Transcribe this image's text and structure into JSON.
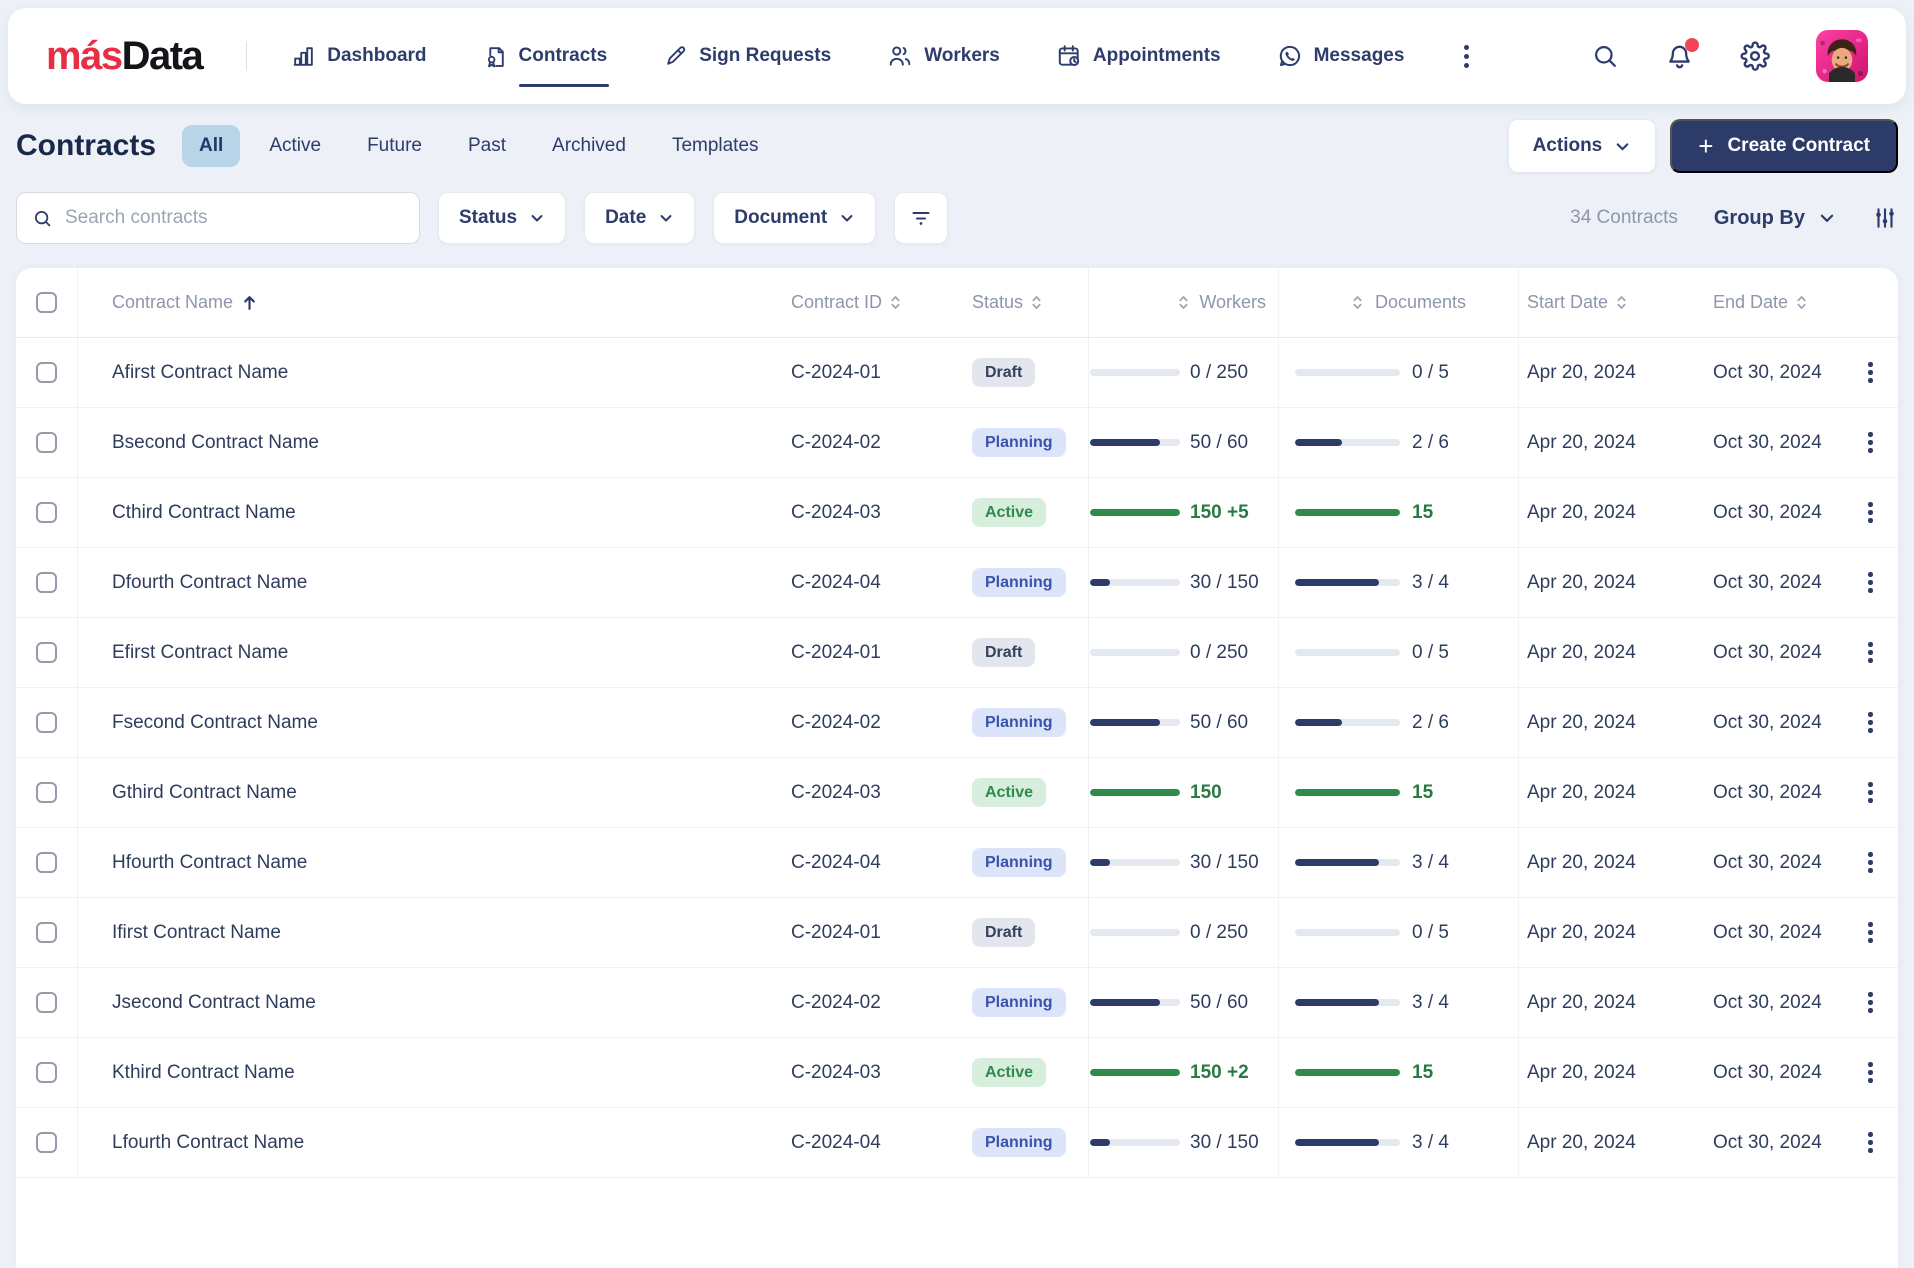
{
  "brand": {
    "red": "más",
    "dark": "Data"
  },
  "nav": {
    "items": [
      {
        "key": "dashboard",
        "label": "Dashboard",
        "active": false
      },
      {
        "key": "contracts",
        "label": "Contracts",
        "active": true
      },
      {
        "key": "sign-requests",
        "label": "Sign Requests",
        "active": false
      },
      {
        "key": "workers",
        "label": "Workers",
        "active": false
      },
      {
        "key": "appointments",
        "label": "Appointments",
        "active": false
      },
      {
        "key": "messages",
        "label": "Messages",
        "active": false
      }
    ]
  },
  "header": {
    "title": "Contracts",
    "tabs": [
      "All",
      "Active",
      "Future",
      "Past",
      "Archived",
      "Templates"
    ],
    "active_tab": "All",
    "actions_label": "Actions",
    "create_label": "Create Contract"
  },
  "filters": {
    "search_placeholder": "Search contracts",
    "dropdowns": [
      "Status",
      "Date",
      "Document"
    ],
    "count_label": "34 Contracts",
    "group_by_label": "Group By"
  },
  "table": {
    "columns": [
      {
        "label": "Contract Name",
        "sort": "asc"
      },
      {
        "label": "Contract ID",
        "sort": "none"
      },
      {
        "label": "Status",
        "sort": "none"
      },
      {
        "label": "Workers",
        "sort": "none"
      },
      {
        "label": "Documents",
        "sort": "none"
      },
      {
        "label": "Start Date",
        "sort": "none"
      },
      {
        "label": "End Date",
        "sort": "none"
      }
    ],
    "rows": [
      {
        "name": "Afirst Contract Name",
        "id": "C-2024-01",
        "status": "Draft",
        "status_type": "draft",
        "accent": "navy",
        "workers": {
          "pct": 0,
          "label": "0 / 250"
        },
        "documents": {
          "pct": 0,
          "label": "0 / 5"
        },
        "start": "Apr 20, 2024",
        "end": "Oct 30, 2024"
      },
      {
        "name": "Bsecond Contract Name",
        "id": "C-2024-02",
        "status": "Planning",
        "status_type": "planning",
        "accent": "navy",
        "workers": {
          "pct": 78,
          "label": "50 / 60"
        },
        "documents": {
          "pct": 45,
          "label": "2 / 6"
        },
        "start": "Apr 20, 2024",
        "end": "Oct 30, 2024"
      },
      {
        "name": "Cthird Contract Name",
        "id": "C-2024-03",
        "status": "Active",
        "status_type": "active",
        "accent": "green",
        "workers": {
          "pct": 100,
          "label": "150 +5"
        },
        "documents": {
          "pct": 100,
          "label": "15"
        },
        "start": "Apr 20, 2024",
        "end": "Oct 30, 2024"
      },
      {
        "name": "Dfourth Contract Name",
        "id": "C-2024-04",
        "status": "Planning",
        "status_type": "planning",
        "accent": "navy",
        "workers": {
          "pct": 22,
          "label": "30 / 150"
        },
        "documents": {
          "pct": 80,
          "label": "3 / 4"
        },
        "start": "Apr 20, 2024",
        "end": "Oct 30, 2024"
      },
      {
        "name": "Efirst Contract Name",
        "id": "C-2024-01",
        "status": "Draft",
        "status_type": "draft",
        "accent": "navy",
        "workers": {
          "pct": 0,
          "label": "0 / 250"
        },
        "documents": {
          "pct": 0,
          "label": "0 / 5"
        },
        "start": "Apr 20, 2024",
        "end": "Oct 30, 2024"
      },
      {
        "name": "Fsecond Contract Name",
        "id": "C-2024-02",
        "status": "Planning",
        "status_type": "planning",
        "accent": "navy",
        "workers": {
          "pct": 78,
          "label": "50 / 60"
        },
        "documents": {
          "pct": 45,
          "label": "2 / 6"
        },
        "start": "Apr 20, 2024",
        "end": "Oct 30, 2024"
      },
      {
        "name": "Gthird Contract Name",
        "id": "C-2024-03",
        "status": "Active",
        "status_type": "active",
        "accent": "green",
        "workers": {
          "pct": 100,
          "label": "150"
        },
        "documents": {
          "pct": 100,
          "label": "15"
        },
        "start": "Apr 20, 2024",
        "end": "Oct 30, 2024"
      },
      {
        "name": "Hfourth Contract Name",
        "id": "C-2024-04",
        "status": "Planning",
        "status_type": "planning",
        "accent": "navy",
        "workers": {
          "pct": 22,
          "label": "30 / 150"
        },
        "documents": {
          "pct": 80,
          "label": "3 / 4"
        },
        "start": "Apr 20, 2024",
        "end": "Oct 30, 2024"
      },
      {
        "name": "Ifirst Contract Name",
        "id": "C-2024-01",
        "status": "Draft",
        "status_type": "draft",
        "accent": "navy",
        "workers": {
          "pct": 0,
          "label": "0 / 250"
        },
        "documents": {
          "pct": 0,
          "label": "0 / 5"
        },
        "start": "Apr 20, 2024",
        "end": "Oct 30, 2024"
      },
      {
        "name": "Jsecond Contract Name",
        "id": "C-2024-02",
        "status": "Planning",
        "status_type": "planning",
        "accent": "navy",
        "workers": {
          "pct": 78,
          "label": "50 / 60"
        },
        "documents": {
          "pct": 80,
          "label": "3 / 4"
        },
        "start": "Apr 20, 2024",
        "end": "Oct 30, 2024"
      },
      {
        "name": "Kthird Contract Name",
        "id": "C-2024-03",
        "status": "Active",
        "status_type": "active",
        "accent": "green",
        "workers": {
          "pct": 100,
          "label": "150 +2"
        },
        "documents": {
          "pct": 100,
          "label": "15"
        },
        "start": "Apr 20, 2024",
        "end": "Oct 30, 2024"
      },
      {
        "name": "Lfourth Contract Name",
        "id": "C-2024-04",
        "status": "Planning",
        "status_type": "planning",
        "accent": "navy",
        "workers": {
          "pct": 22,
          "label": "30 / 150"
        },
        "documents": {
          "pct": 80,
          "label": "3 / 4"
        },
        "start": "Apr 20, 2024",
        "end": "Oct 30, 2024"
      }
    ]
  },
  "colors": {
    "navy": "#2d3b69",
    "brand_red": "#e62e45",
    "notification_red": "#f2455c",
    "green": "#2e8b4a",
    "active_badge_bg": "#d8eedd",
    "planning_badge_bg": "#dce4fa",
    "planning_text": "#3a53ab",
    "draft_badge_bg": "#e3e7ed",
    "selected_tab_bg": "#b7d4e9",
    "page_bg": "#edf1f7"
  }
}
